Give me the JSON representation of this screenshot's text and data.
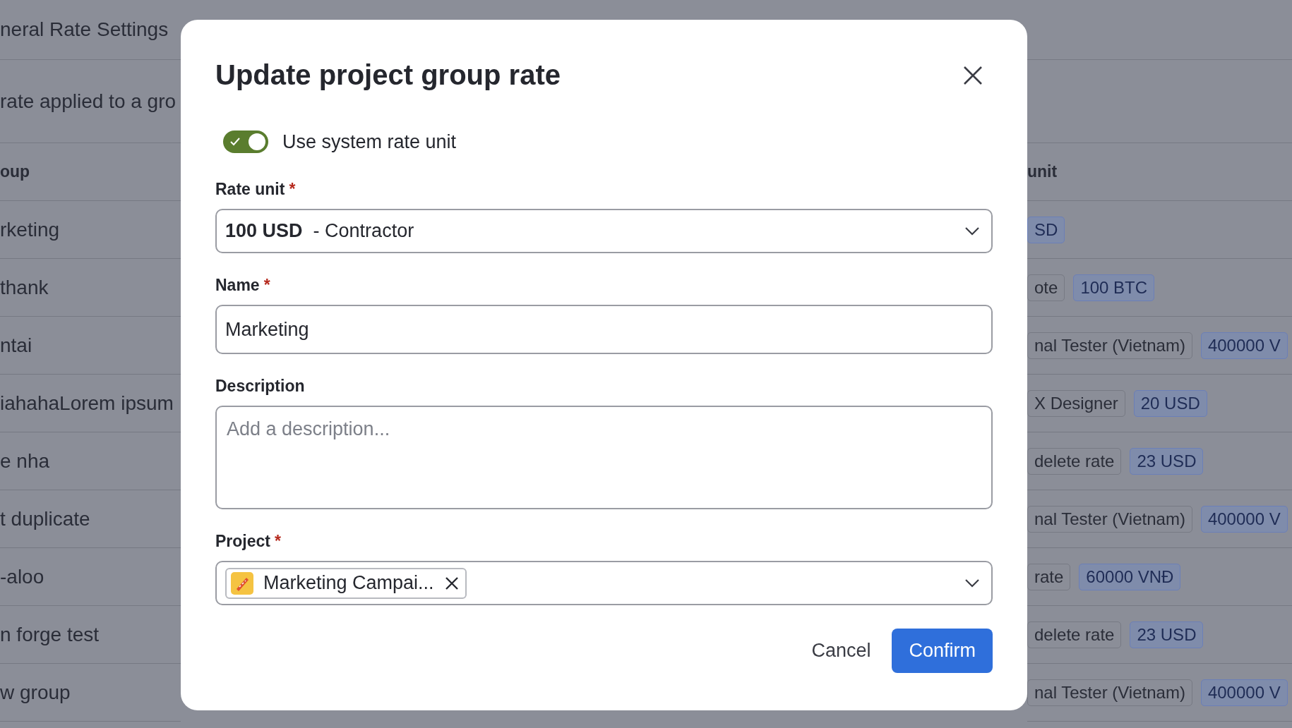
{
  "background": {
    "page_title": "neral Rate Settings",
    "description": "rate applied to a gro",
    "columns": [
      "oup",
      "unit"
    ],
    "rows": [
      {
        "group": "rketing",
        "tags": [
          {
            "label": "SD",
            "kind": "rate"
          }
        ]
      },
      {
        "group": "thank",
        "tags": [
          {
            "label": "ote",
            "kind": "role"
          },
          {
            "label": "100 BTC",
            "kind": "rate"
          }
        ]
      },
      {
        "group": "ntai",
        "tags": [
          {
            "label": "nal Tester (Vietnam)",
            "kind": "role"
          },
          {
            "label": "400000 V",
            "kind": "rate"
          }
        ]
      },
      {
        "group": "iahahaLorem ipsum",
        "tags": [
          {
            "label": "X Designer",
            "kind": "role"
          },
          {
            "label": "20 USD",
            "kind": "rate"
          }
        ]
      },
      {
        "group": "e nha",
        "tags": [
          {
            "label": "delete rate",
            "kind": "role"
          },
          {
            "label": "23 USD",
            "kind": "rate"
          }
        ]
      },
      {
        "group": "t duplicate",
        "tags": [
          {
            "label": "nal Tester (Vietnam)",
            "kind": "role"
          },
          {
            "label": "400000 V",
            "kind": "rate"
          }
        ]
      },
      {
        "group": "-aloo",
        "tags": [
          {
            "label": "rate",
            "kind": "role"
          },
          {
            "label": "60000 VNĐ",
            "kind": "rate"
          }
        ]
      },
      {
        "group": "n forge test",
        "tags": [
          {
            "label": "delete rate",
            "kind": "role"
          },
          {
            "label": "23 USD",
            "kind": "rate"
          }
        ]
      },
      {
        "group": "w group",
        "tags": [
          {
            "label": "nal Tester (Vietnam)",
            "kind": "role"
          },
          {
            "label": "400000 V",
            "kind": "rate"
          }
        ]
      }
    ]
  },
  "dialog": {
    "title": "Update project group rate",
    "required_mark": "*",
    "toggle": {
      "label": "Use system rate unit",
      "on": true
    },
    "rate_unit": {
      "label": "Rate unit",
      "required": true,
      "amount": "100 USD",
      "role": "- Contractor"
    },
    "name": {
      "label": "Name",
      "required": true,
      "value": "Marketing"
    },
    "description": {
      "label": "Description",
      "required": false,
      "placeholder": "Add a description..."
    },
    "project": {
      "label": "Project",
      "required": true,
      "chips": [
        {
          "label": "Marketing Campai..."
        }
      ]
    },
    "buttons": {
      "cancel": "Cancel",
      "confirm": "Confirm"
    }
  }
}
